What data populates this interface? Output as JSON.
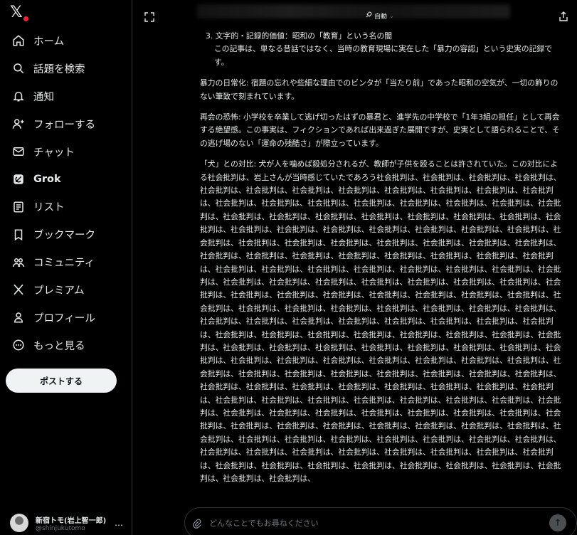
{
  "nav": {
    "items": [
      {
        "label": "ホーム",
        "icon": "home-icon"
      },
      {
        "label": "話題を検索",
        "icon": "search-icon"
      },
      {
        "label": "通知",
        "icon": "bell-icon"
      },
      {
        "label": "フォローする",
        "icon": "add-user-icon"
      },
      {
        "label": "チャット",
        "icon": "mail-icon"
      },
      {
        "label": "Grok",
        "icon": "grok-icon"
      },
      {
        "label": "リスト",
        "icon": "list-icon"
      },
      {
        "label": "ブックマーク",
        "icon": "bookmark-icon"
      },
      {
        "label": "コミュニティ",
        "icon": "community-icon"
      },
      {
        "label": "プレミアム",
        "icon": "x-icon"
      },
      {
        "label": "プロフィール",
        "icon": "person-icon"
      },
      {
        "label": "もっと見る",
        "icon": "more-circle-icon"
      }
    ],
    "post_label": "ポストする"
  },
  "account": {
    "name": "新宿トモ(岩上智一郎)",
    "handle": "@shinjukutomo",
    "more": "…"
  },
  "topbar": {
    "mode_label": "自動"
  },
  "content": {
    "item3_title": "3. 文字的・記録的価値：昭和の「教育」という名の闇",
    "item3_body": "この記事は、単なる昔話ではなく、当時の教育現場に実在した「暴力の容認」という史実の記録です。",
    "para1": "暴力の日常化: 宿題の忘れや些細な理由でのビンタが「当たり前」であった昭和の空気が、一切の飾りのない筆致で刻まれています。",
    "para2": "再会の恐怖: 小学校を卒業して逃げ切ったはずの暴君と、進学先の中学校で「1年3組の担任」として再会する絶望感。この事実は、フィクションであれば出来過ぎた展開ですが、史実として語られることで、その逃げ場のない「運命の残酷さ」が際立っています。",
    "para3_intro": "「犬」との対比: 犬が人を噛めば殺処分されるが、教師が子供を殴ることは許されていた。この対比による社会批判は、岩上さんが当時感じていたであろう",
    "repeat_phrase": "社会批判は、",
    "repeat_count": 178
  },
  "composer": {
    "placeholder": "どんなことでもお尋ねください"
  }
}
